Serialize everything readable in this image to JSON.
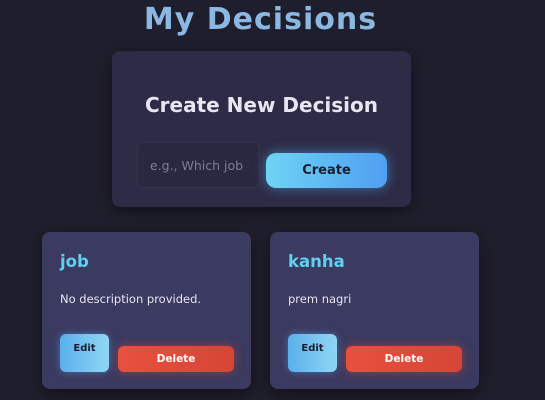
{
  "page": {
    "title": "My Decisions"
  },
  "create": {
    "title": "Create New Decision",
    "input_placeholder": "e.g., Which job c",
    "input_value": "",
    "button_label": "Create"
  },
  "decisions": [
    {
      "title": "job",
      "description": "No description provided.",
      "edit_label": "Edit",
      "delete_label": "Delete"
    },
    {
      "title": "kanha",
      "description": "prem nagri",
      "edit_label": "Edit",
      "delete_label": "Delete"
    }
  ],
  "colors": {
    "background": "#1f1e2c",
    "title": "#8bb8e3",
    "card": "#3b3a60",
    "accent": "#5fd0f0",
    "danger": "#e8503e"
  }
}
